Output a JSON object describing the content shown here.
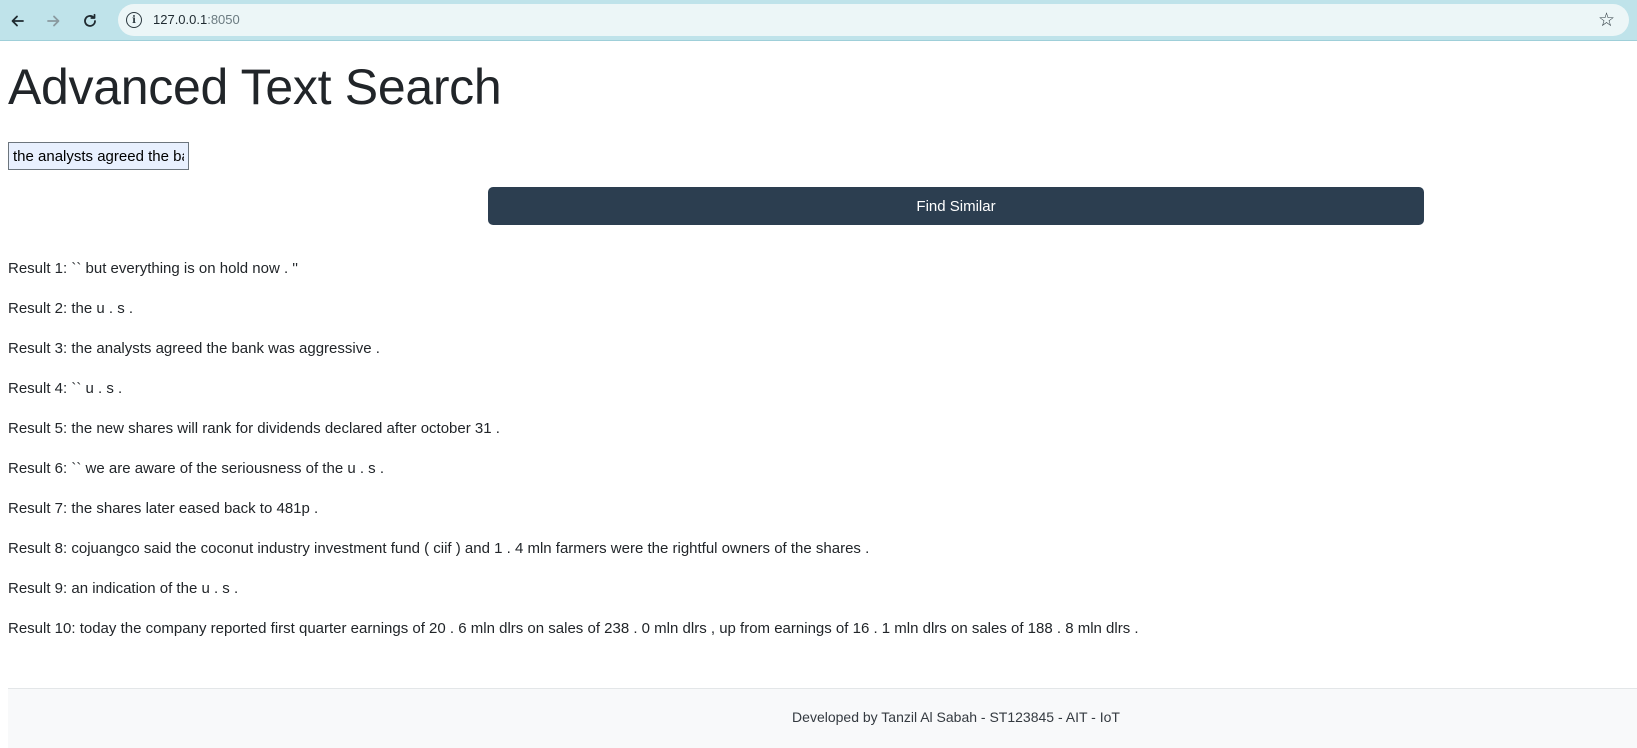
{
  "browser": {
    "url_host": "127.0.0.1",
    "url_port": ":8050"
  },
  "page": {
    "title": "Advanced Text Search",
    "search": {
      "value": "the analysts agreed the bank was aggressive ."
    },
    "find_button_label": "Find Similar",
    "results": [
      "Result 1: `` but everything is on hold now . ''",
      "Result 2: the u . s .",
      "Result 3: the analysts agreed the bank was aggressive .",
      "Result 4: `` u . s .",
      "Result 5: the new shares will rank for dividends declared after october 31 .",
      "Result 6: `` we are aware of the seriousness of the u . s .",
      "Result 7: the shares later eased back to 481p .",
      "Result 8: cojuangco said the coconut industry investment fund ( ciif ) and 1 . 4 mln farmers were the rightful owners of the shares .",
      "Result 9: an indication of the u . s .",
      "Result 10: today the company reported first quarter earnings of 20 . 6 mln dlrs on sales of 238 . 0 mln dlrs , up from earnings of 16 . 1 mln dlrs on sales of 188 . 8 mln dlrs ."
    ],
    "footer": "Developed by Tanzil Al Sabah - ST123845 - AIT - IoT"
  },
  "colors": {
    "button_bg": "#2c3e50",
    "browser_bar": "#bfe3ea"
  }
}
